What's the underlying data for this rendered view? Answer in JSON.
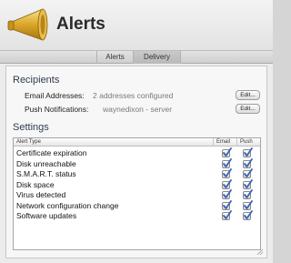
{
  "app": {
    "title": "Alerts"
  },
  "tabs": [
    {
      "label": "Alerts",
      "selected": false
    },
    {
      "label": "Delivery",
      "selected": true
    }
  ],
  "recipients": {
    "heading": "Recipients",
    "email": {
      "label": "Email Addresses:",
      "value": "2 addresses configured",
      "button": "Edit..."
    },
    "push": {
      "label": "Push Notifications:",
      "value": "waynedixon - server",
      "button": "Edit..."
    }
  },
  "settings": {
    "heading": "Settings",
    "columns": {
      "type": "Alert Type",
      "email": "Email",
      "push": "Push"
    },
    "rows": [
      {
        "type": "Certificate expiration",
        "email": true,
        "push": true
      },
      {
        "type": "Disk unreachable",
        "email": true,
        "push": true
      },
      {
        "type": "S.M.A.R.T. status",
        "email": true,
        "push": true
      },
      {
        "type": "Disk space",
        "email": true,
        "push": true
      },
      {
        "type": "Virus detected",
        "email": true,
        "push": true
      },
      {
        "type": "Network configuration change",
        "email": true,
        "push": true
      },
      {
        "type": "Software updates",
        "email": true,
        "push": true
      }
    ]
  },
  "colors": {
    "checkmark": "#3a64b5",
    "section_heading": "#2f3d4c"
  }
}
